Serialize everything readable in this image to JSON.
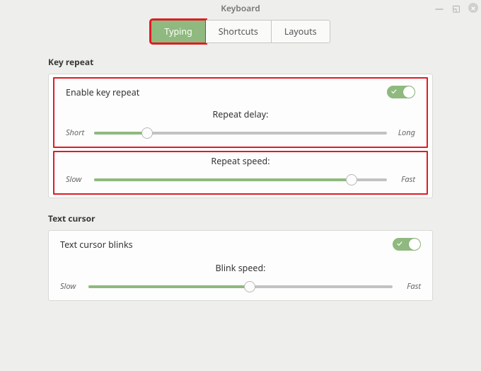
{
  "window": {
    "title": "Keyboard"
  },
  "tabs": [
    {
      "label": "Typing",
      "active": true,
      "highlight": true
    },
    {
      "label": "Shortcuts",
      "active": false
    },
    {
      "label": "Layouts",
      "active": false
    }
  ],
  "sections": {
    "key_repeat": {
      "heading": "Key repeat",
      "enable_label": "Enable key repeat",
      "enabled": true,
      "delay": {
        "title": "Repeat delay:",
        "min_label": "Short",
        "max_label": "Long",
        "value_pct": 18
      },
      "speed": {
        "title": "Repeat speed:",
        "min_label": "Slow",
        "max_label": "Fast",
        "value_pct": 88
      }
    },
    "text_cursor": {
      "heading": "Text cursor",
      "blinks_label": "Text cursor blinks",
      "blinks": true,
      "blink_speed": {
        "title": "Blink speed:",
        "min_label": "Slow",
        "max_label": "Fast",
        "value_pct": 53
      }
    }
  }
}
